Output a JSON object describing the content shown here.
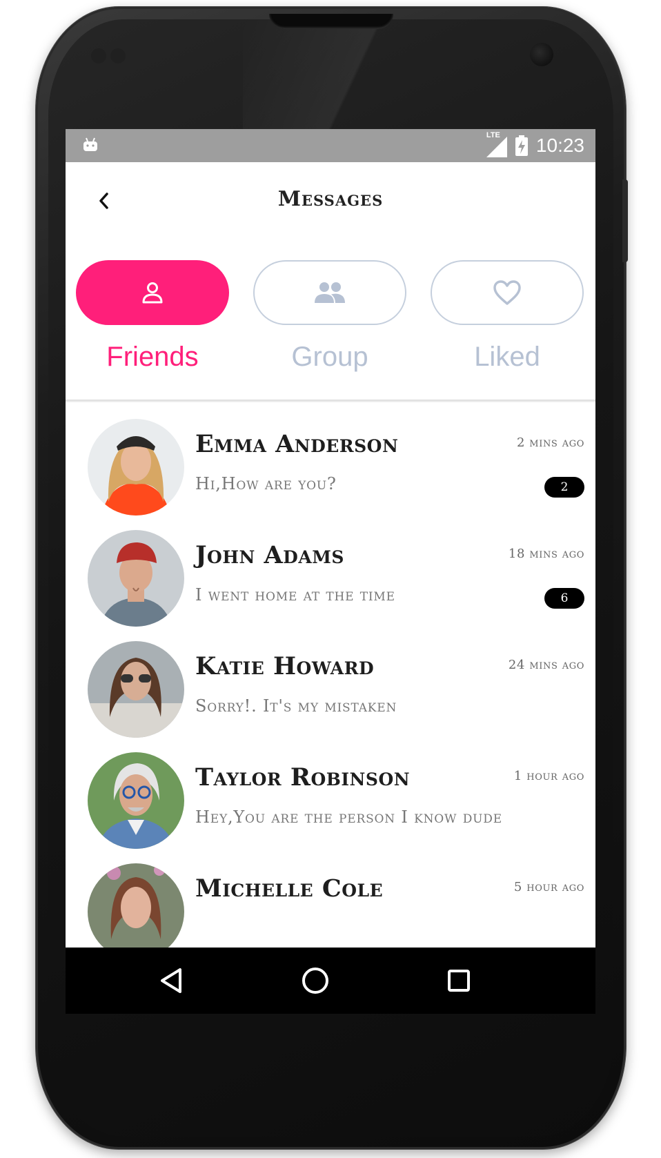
{
  "status_bar": {
    "network": "LTE",
    "time": "10:23",
    "icons": [
      "android-notification-icon",
      "lte-signal-icon",
      "battery-charging-icon"
    ]
  },
  "header": {
    "title": "Messages",
    "back_icon": "chevron-left-icon"
  },
  "tabs": [
    {
      "label": "Friends",
      "icon": "person-icon",
      "active": true
    },
    {
      "label": "Group",
      "icon": "group-icon",
      "active": false
    },
    {
      "label": "Liked",
      "icon": "heart-icon",
      "active": false
    }
  ],
  "colors": {
    "accent": "#ff1f7a",
    "inactive": "#b6c1d3",
    "badge": "#000000",
    "status_bar": "#9e9e9e"
  },
  "messages": [
    {
      "name": "Emma Anderson",
      "preview": "Hi,How are you?",
      "time": "2 mins ago",
      "unread": "2"
    },
    {
      "name": "John Adams",
      "preview": "I went home at the time",
      "time": "18 mins ago",
      "unread": "6"
    },
    {
      "name": "Katie Howard",
      "preview": "Sorry!. It's my mistaken",
      "time": "24 mins ago",
      "unread": null
    },
    {
      "name": "Taylor Robinson",
      "preview": "Hey,You are the person I know dude",
      "time": "1 hour ago",
      "unread": null
    },
    {
      "name": "Michelle Cole",
      "preview": "",
      "time": "5 hour ago",
      "unread": null
    }
  ],
  "nav_bar": [
    "back-triangle-icon",
    "home-circle-icon",
    "recents-square-icon"
  ]
}
